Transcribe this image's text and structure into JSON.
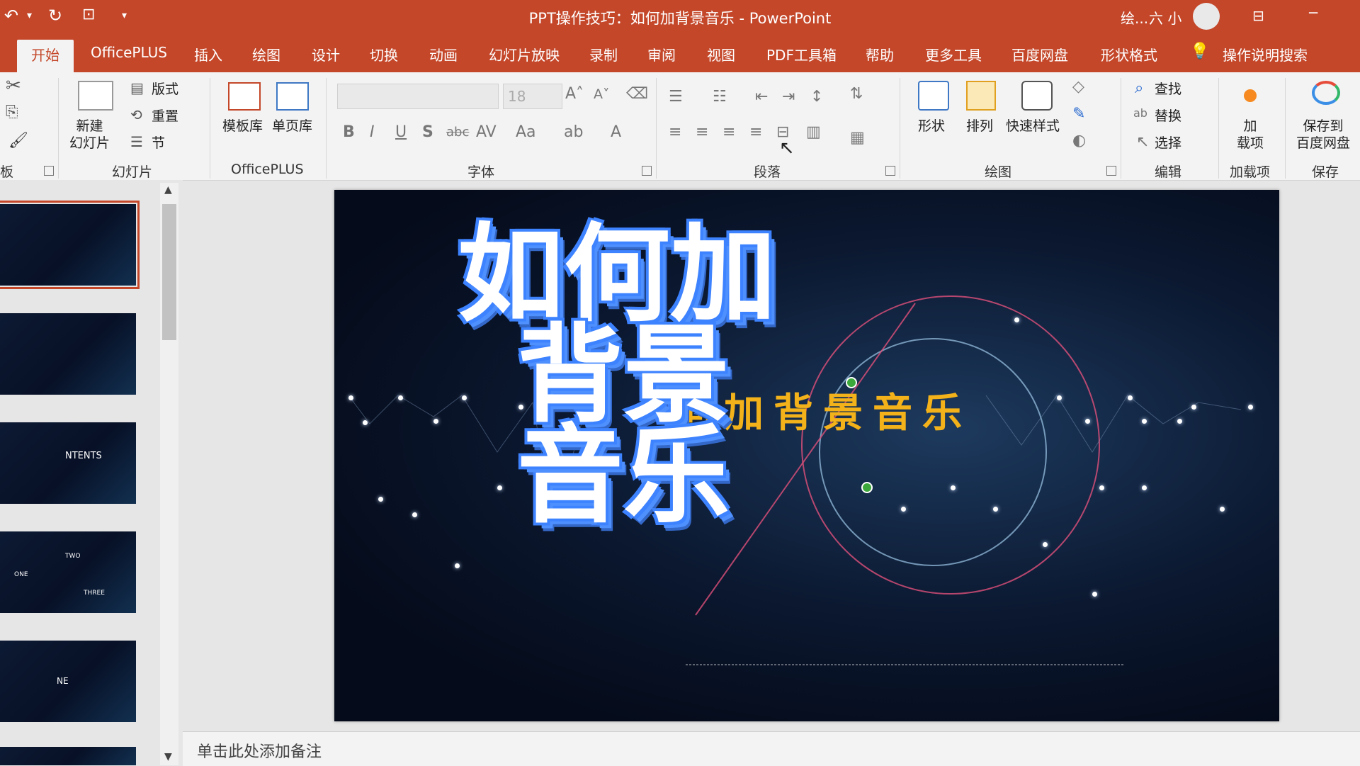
{
  "window": {
    "title": "PPT操作技巧：如何加背景音乐  -  PowerPoint",
    "user_name": "六 小",
    "draw_truncated": "绘..."
  },
  "tabs": [
    "开始",
    "OfficePLUS",
    "插入",
    "绘图",
    "设计",
    "切换",
    "动画",
    "幻灯片放映",
    "录制",
    "审阅",
    "视图",
    "PDF工具箱",
    "帮助",
    "更多工具",
    "百度网盘",
    "形状格式",
    "操作说明搜索"
  ],
  "active_tab": "开始",
  "ribbon": {
    "clipboard": {
      "label": "板"
    },
    "slides": {
      "label": "幻灯片",
      "new_slide": "新建\n幻灯片",
      "layout": "版式",
      "reset": "重置",
      "section": "节"
    },
    "officeplus": {
      "label": "OfficePLUS",
      "templates": "模板库",
      "single_page": "单页库"
    },
    "font": {
      "label": "字体",
      "font_size": "18"
    },
    "paragraph": {
      "label": "段落"
    },
    "drawing": {
      "label": "绘图",
      "shape": "形状",
      "arrange": "排列",
      "quick_styles": "快速样式"
    },
    "editing": {
      "label": "编辑",
      "find": "查找",
      "replace": "替换",
      "select": "选择"
    },
    "addins": {
      "label": "加载项",
      "addin": "加\n载项"
    },
    "save": {
      "label": "保存",
      "save_to": "保存到\n百度网盘"
    }
  },
  "slide": {
    "big_title_1": "如何加",
    "big_title_2": "背景",
    "big_title_3": "音乐",
    "subtitle": "何加背景音乐"
  },
  "thumbnails": {
    "thumb3_text": "NTENTS",
    "thumb4_one": "ONE",
    "thumb4_two": "TWO",
    "thumb4_three": "THREE",
    "thumb5_text": "NE"
  },
  "notes": {
    "placeholder": "单击此处添加备注"
  },
  "colors": {
    "accent": "#c4472a",
    "title_blue": "#3d82ff",
    "subtitle_gold": "#f3b21a"
  }
}
